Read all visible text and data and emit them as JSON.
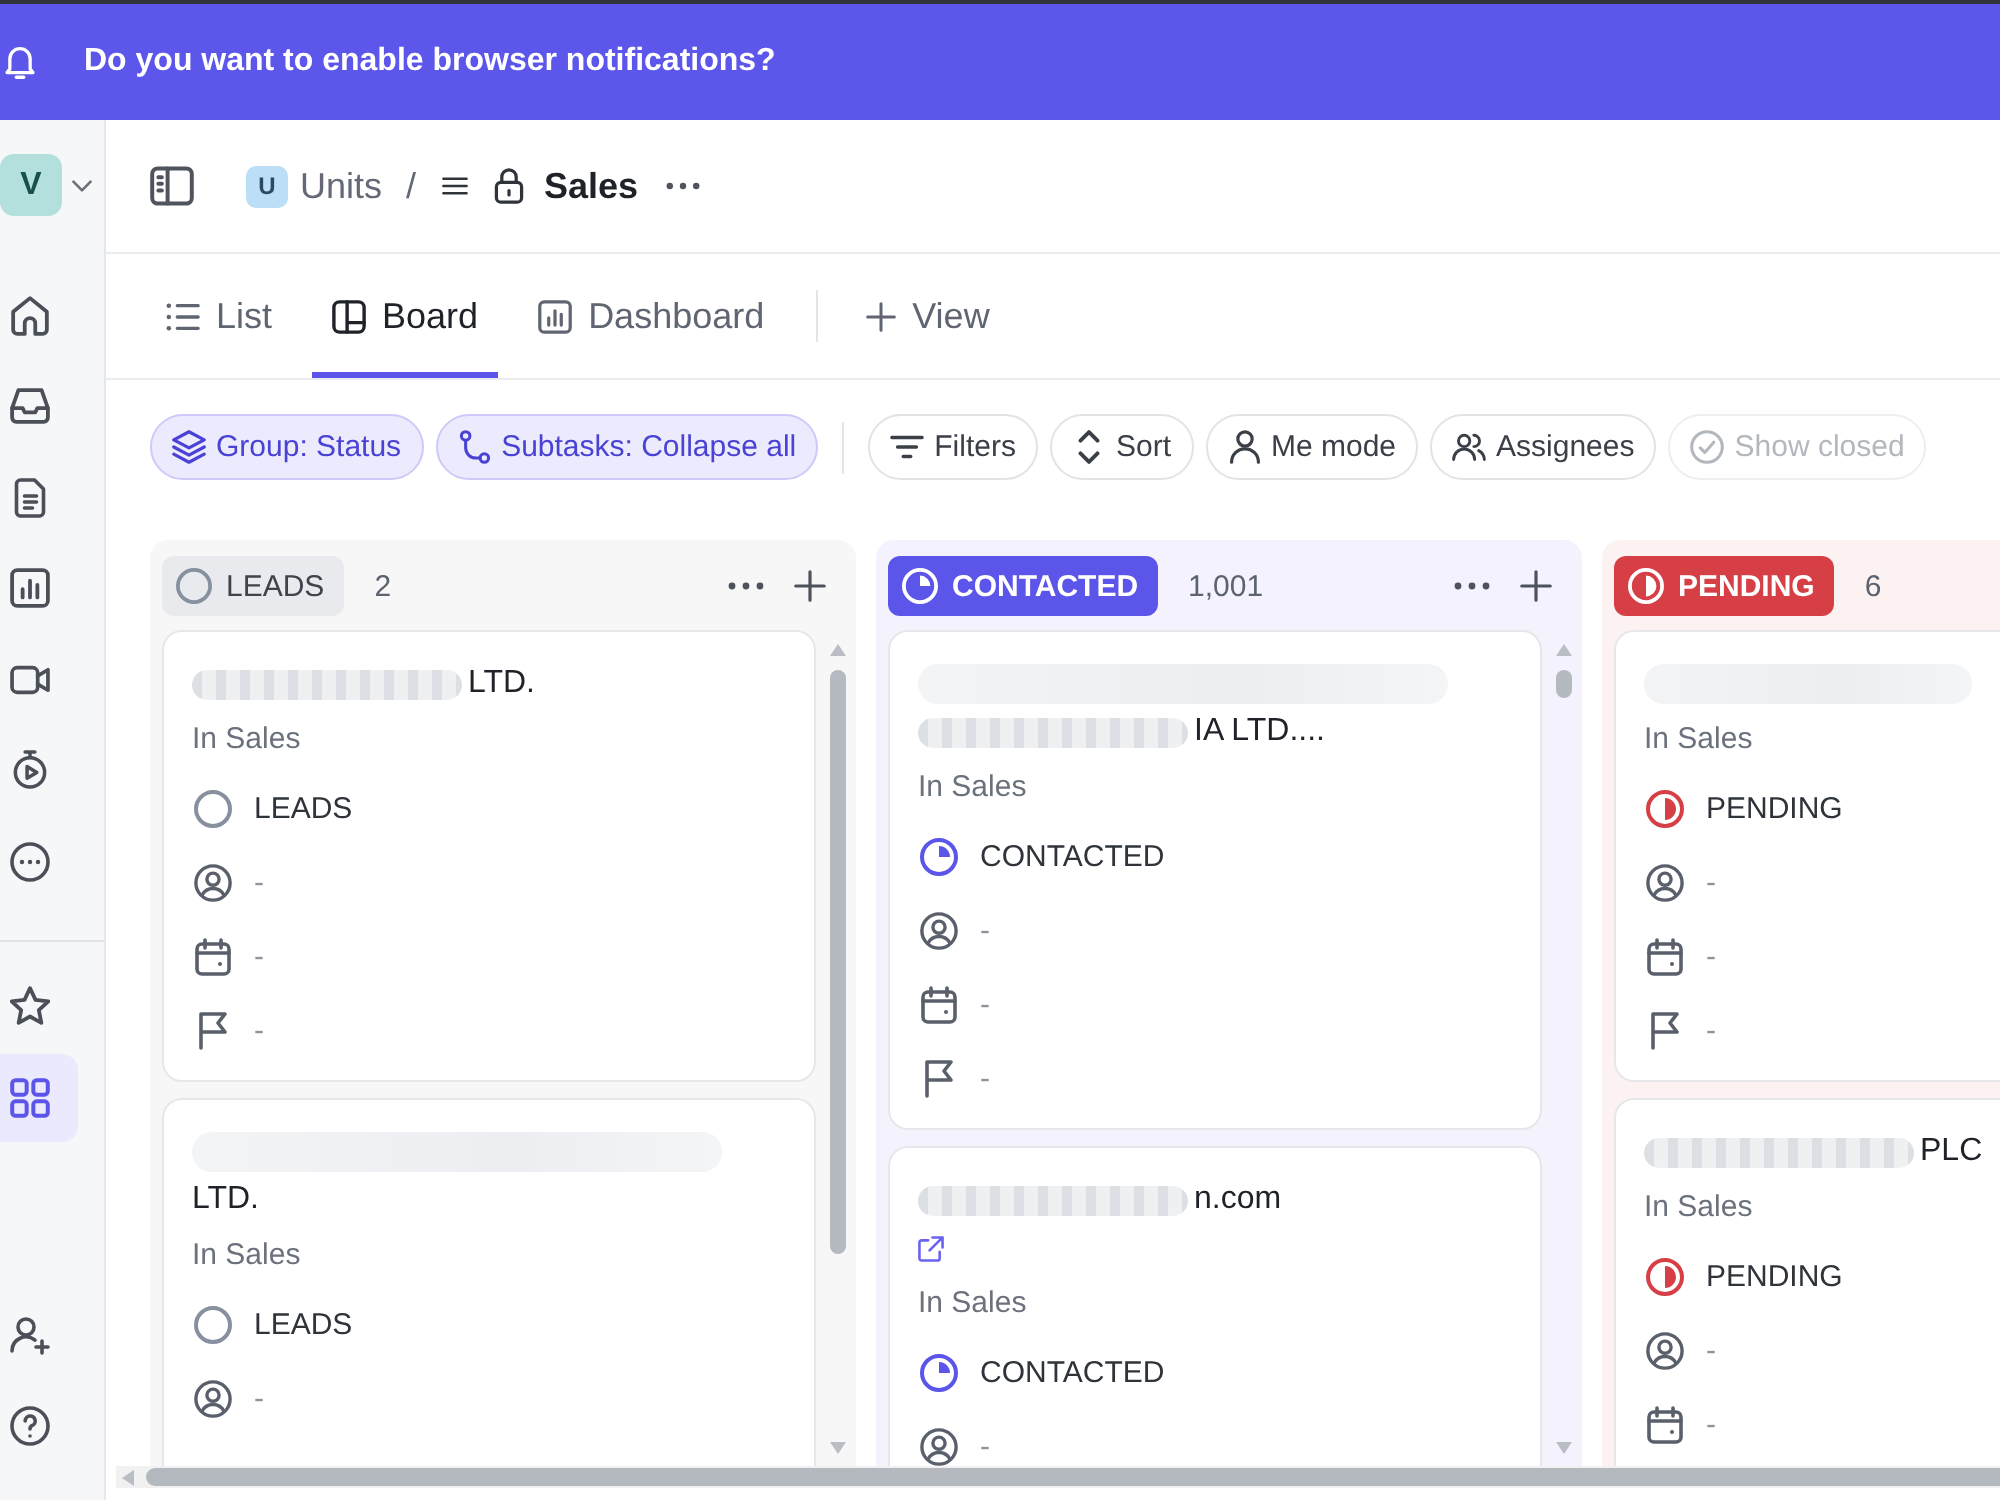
{
  "banner": {
    "text": "Do you want to enable browser notifications?"
  },
  "sidebar": {
    "avatar": "V",
    "top": [
      {
        "kind": "home",
        "selected": false
      },
      {
        "kind": "inbox",
        "selected": false
      },
      {
        "kind": "docs",
        "selected": false
      },
      {
        "kind": "dashboards",
        "selected": false
      },
      {
        "kind": "clips",
        "selected": false
      },
      {
        "kind": "timesheets",
        "selected": false
      },
      {
        "kind": "more",
        "selected": false
      }
    ],
    "middle": [
      {
        "kind": "favorites",
        "selected": false
      },
      {
        "kind": "spaces",
        "selected": true
      }
    ],
    "bottom": [
      {
        "kind": "invite",
        "selected": false
      },
      {
        "kind": "help",
        "selected": false
      }
    ]
  },
  "breadcrumb": {
    "space_badge": "U",
    "space": "Units",
    "separator": "/",
    "list": "Sales"
  },
  "tabs": [
    {
      "kind": "list",
      "label": "List",
      "selected": false
    },
    {
      "kind": "board",
      "label": "Board",
      "selected": true
    },
    {
      "kind": "dashboard",
      "label": "Dashboard",
      "selected": false
    }
  ],
  "add_view": {
    "label": "View"
  },
  "toolbar": {
    "view_options": [
      {
        "kind": "group",
        "label": "Group: Status",
        "active": true,
        "disabled": false
      },
      {
        "kind": "subtasks",
        "label": "Subtasks: Collapse all",
        "active": true,
        "disabled": false
      }
    ],
    "filters": [
      {
        "kind": "filters",
        "label": "Filters",
        "active": false,
        "disabled": false
      },
      {
        "kind": "sort",
        "label": "Sort",
        "active": false,
        "disabled": false
      },
      {
        "kind": "me",
        "label": "Me mode",
        "active": false,
        "disabled": false
      },
      {
        "kind": "assignees",
        "label": "Assignees",
        "active": false,
        "disabled": false
      },
      {
        "kind": "closed",
        "label": "Show closed",
        "active": false,
        "disabled": true
      }
    ]
  },
  "columns": [
    {
      "kind": "open",
      "status": "LEADS",
      "count": "2",
      "color": "#87909e",
      "clipped": false,
      "cards": [
        {
          "title_lines": [
            {
              "redacted": true,
              "text": "LTD."
            }
          ],
          "link": false,
          "location": "In Sales",
          "fields": [
            {
              "kind": "status",
              "text": "LEADS"
            },
            {
              "kind": "assignee",
              "text": "-"
            },
            {
              "kind": "due",
              "text": "-"
            },
            {
              "kind": "priority",
              "text": "-"
            }
          ]
        },
        {
          "title_lines": [
            {
              "redacted": true
            },
            {
              "redacted": false,
              "text": "LTD."
            }
          ],
          "link": false,
          "location": "In Sales",
          "fields": [
            {
              "kind": "status",
              "text": "LEADS"
            },
            {
              "kind": "assignee",
              "text": "-"
            }
          ]
        }
      ]
    },
    {
      "kind": "progress",
      "status": "CONTACTED",
      "count": "1,001",
      "color": "#5b55e9",
      "clipped": false,
      "cards": [
        {
          "title_lines": [
            {
              "redacted": true
            },
            {
              "redacted": true,
              "text": "IA LTD...."
            }
          ],
          "link": false,
          "location": "In Sales",
          "fields": [
            {
              "kind": "status",
              "text": "CONTACTED"
            },
            {
              "kind": "assignee",
              "text": "-"
            },
            {
              "kind": "due",
              "text": "-"
            },
            {
              "kind": "priority",
              "text": "-"
            }
          ]
        },
        {
          "title_lines": [
            {
              "redacted": true,
              "text": "n.com"
            }
          ],
          "link": true,
          "location": "In Sales",
          "fields": [
            {
              "kind": "status",
              "text": "CONTACTED"
            },
            {
              "kind": "assignee",
              "text": "-"
            }
          ]
        }
      ]
    },
    {
      "kind": "pending",
      "status": "PENDING",
      "count": "6",
      "color": "#d63f46",
      "clipped": true,
      "cards": [
        {
          "title_lines": [
            {
              "redacted": true
            }
          ],
          "link": false,
          "location": "In Sales",
          "fields": [
            {
              "kind": "status",
              "text": "PENDING"
            },
            {
              "kind": "assignee",
              "text": "-"
            },
            {
              "kind": "due",
              "text": "-"
            },
            {
              "kind": "priority",
              "text": "-"
            }
          ]
        },
        {
          "title_lines": [
            {
              "redacted": true,
              "text": "PLC"
            }
          ],
          "link": false,
          "location": "In Sales",
          "fields": [
            {
              "kind": "status",
              "text": "PENDING"
            },
            {
              "kind": "assignee",
              "text": "-"
            },
            {
              "kind": "due",
              "text": "-"
            }
          ]
        }
      ]
    }
  ]
}
